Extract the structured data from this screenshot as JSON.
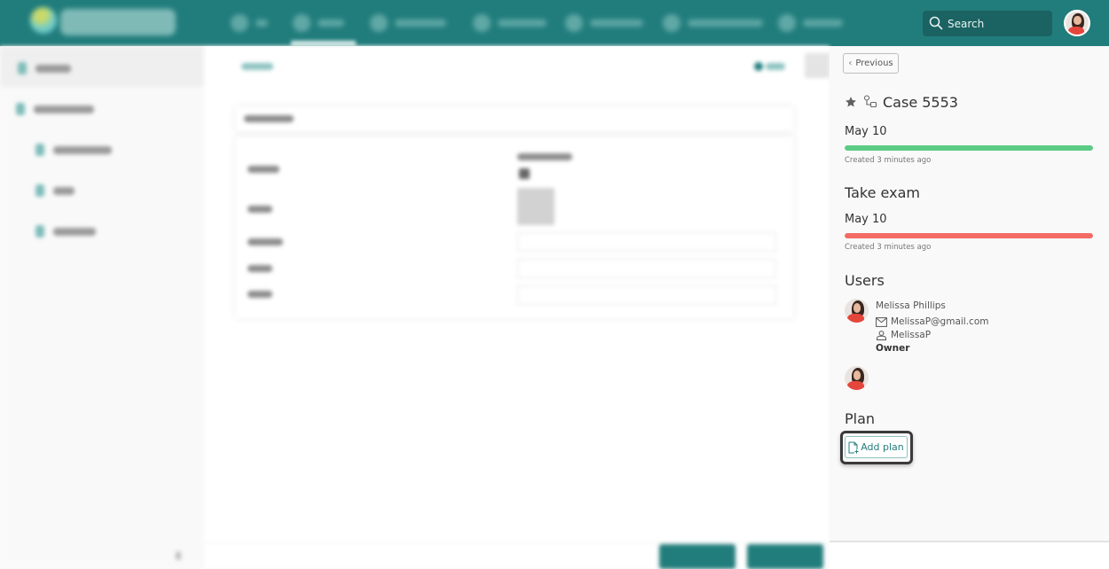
{
  "topbar": {
    "search": {
      "placeholder": "Search",
      "icon": "search-icon"
    },
    "avatar": {
      "icon": "user-avatar"
    },
    "colors": {
      "brand": "#217d7c",
      "search_bg": "#1b6262"
    }
  },
  "panel": {
    "previous_label": "Previous",
    "case": {
      "title": "Case 5553",
      "icons": [
        "star-icon",
        "workflow-icon"
      ],
      "due_date": "May 10",
      "progress": {
        "percent": 100,
        "color": "#5ccb85"
      },
      "created": "Created 3 minutes ago"
    },
    "task": {
      "title": "Take exam",
      "due_date": "May 10",
      "progress": {
        "percent": 100,
        "color": "#f26b64"
      },
      "created": "Created 3 minutes ago"
    },
    "users": {
      "heading": "Users",
      "items": [
        {
          "name": "Melissa Phillips",
          "email": "MelissaP@gmail.com",
          "username": "MelissaP",
          "role": "Owner"
        }
      ]
    },
    "plan": {
      "heading": "Plan",
      "add_label": "Add plan"
    }
  }
}
